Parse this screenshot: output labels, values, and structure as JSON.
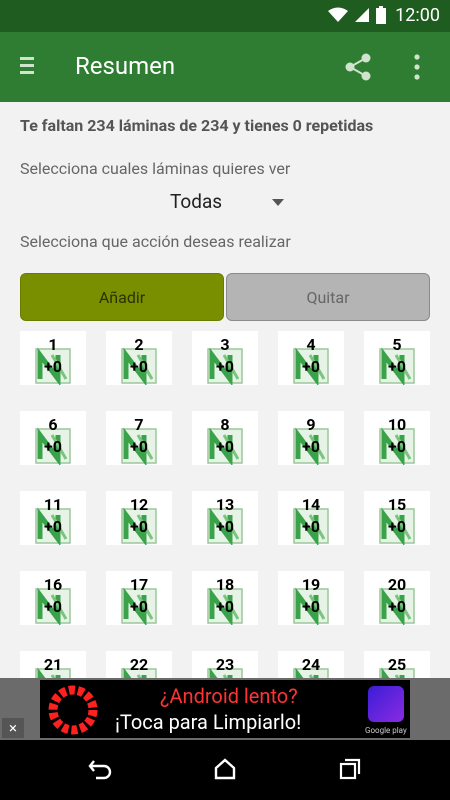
{
  "status_bar": {
    "time": "12:00"
  },
  "app_bar": {
    "title": "Resumen"
  },
  "summary_text": "Te faltan 234 láminas de 234 y tienes 0 repetidas",
  "filter": {
    "label": "Selecciona cuales láminas quieres ver",
    "selected": "Todas"
  },
  "action": {
    "label": "Selecciona que acción deseas realizar",
    "add_label": "Añadir",
    "remove_label": "Quitar"
  },
  "stickers": [
    {
      "number": "1",
      "count": "+0"
    },
    {
      "number": "2",
      "count": "+0"
    },
    {
      "number": "3",
      "count": "+0"
    },
    {
      "number": "4",
      "count": "+0"
    },
    {
      "number": "5",
      "count": "+0"
    },
    {
      "number": "6",
      "count": "+0"
    },
    {
      "number": "7",
      "count": "+0"
    },
    {
      "number": "8",
      "count": "+0"
    },
    {
      "number": "9",
      "count": "+0"
    },
    {
      "number": "10",
      "count": "+0"
    },
    {
      "number": "11",
      "count": "+0"
    },
    {
      "number": "12",
      "count": "+0"
    },
    {
      "number": "13",
      "count": "+0"
    },
    {
      "number": "14",
      "count": "+0"
    },
    {
      "number": "15",
      "count": "+0"
    },
    {
      "number": "16",
      "count": "+0"
    },
    {
      "number": "17",
      "count": "+0"
    },
    {
      "number": "18",
      "count": "+0"
    },
    {
      "number": "19",
      "count": "+0"
    },
    {
      "number": "20",
      "count": "+0"
    },
    {
      "number": "21",
      "count": ""
    },
    {
      "number": "22",
      "count": ""
    },
    {
      "number": "23",
      "count": ""
    },
    {
      "number": "24",
      "count": ""
    },
    {
      "number": "25",
      "count": ""
    }
  ],
  "ad": {
    "line1": "¿Android lento?",
    "line2": "¡Toca para Limpiarlo!",
    "close": "×",
    "store_badge": "Google play"
  },
  "colors": {
    "status_bar": "#1f5c1f",
    "app_bar": "#2e7d32",
    "add_button": "#7a8f00",
    "remove_button": "#b4b4b4"
  }
}
